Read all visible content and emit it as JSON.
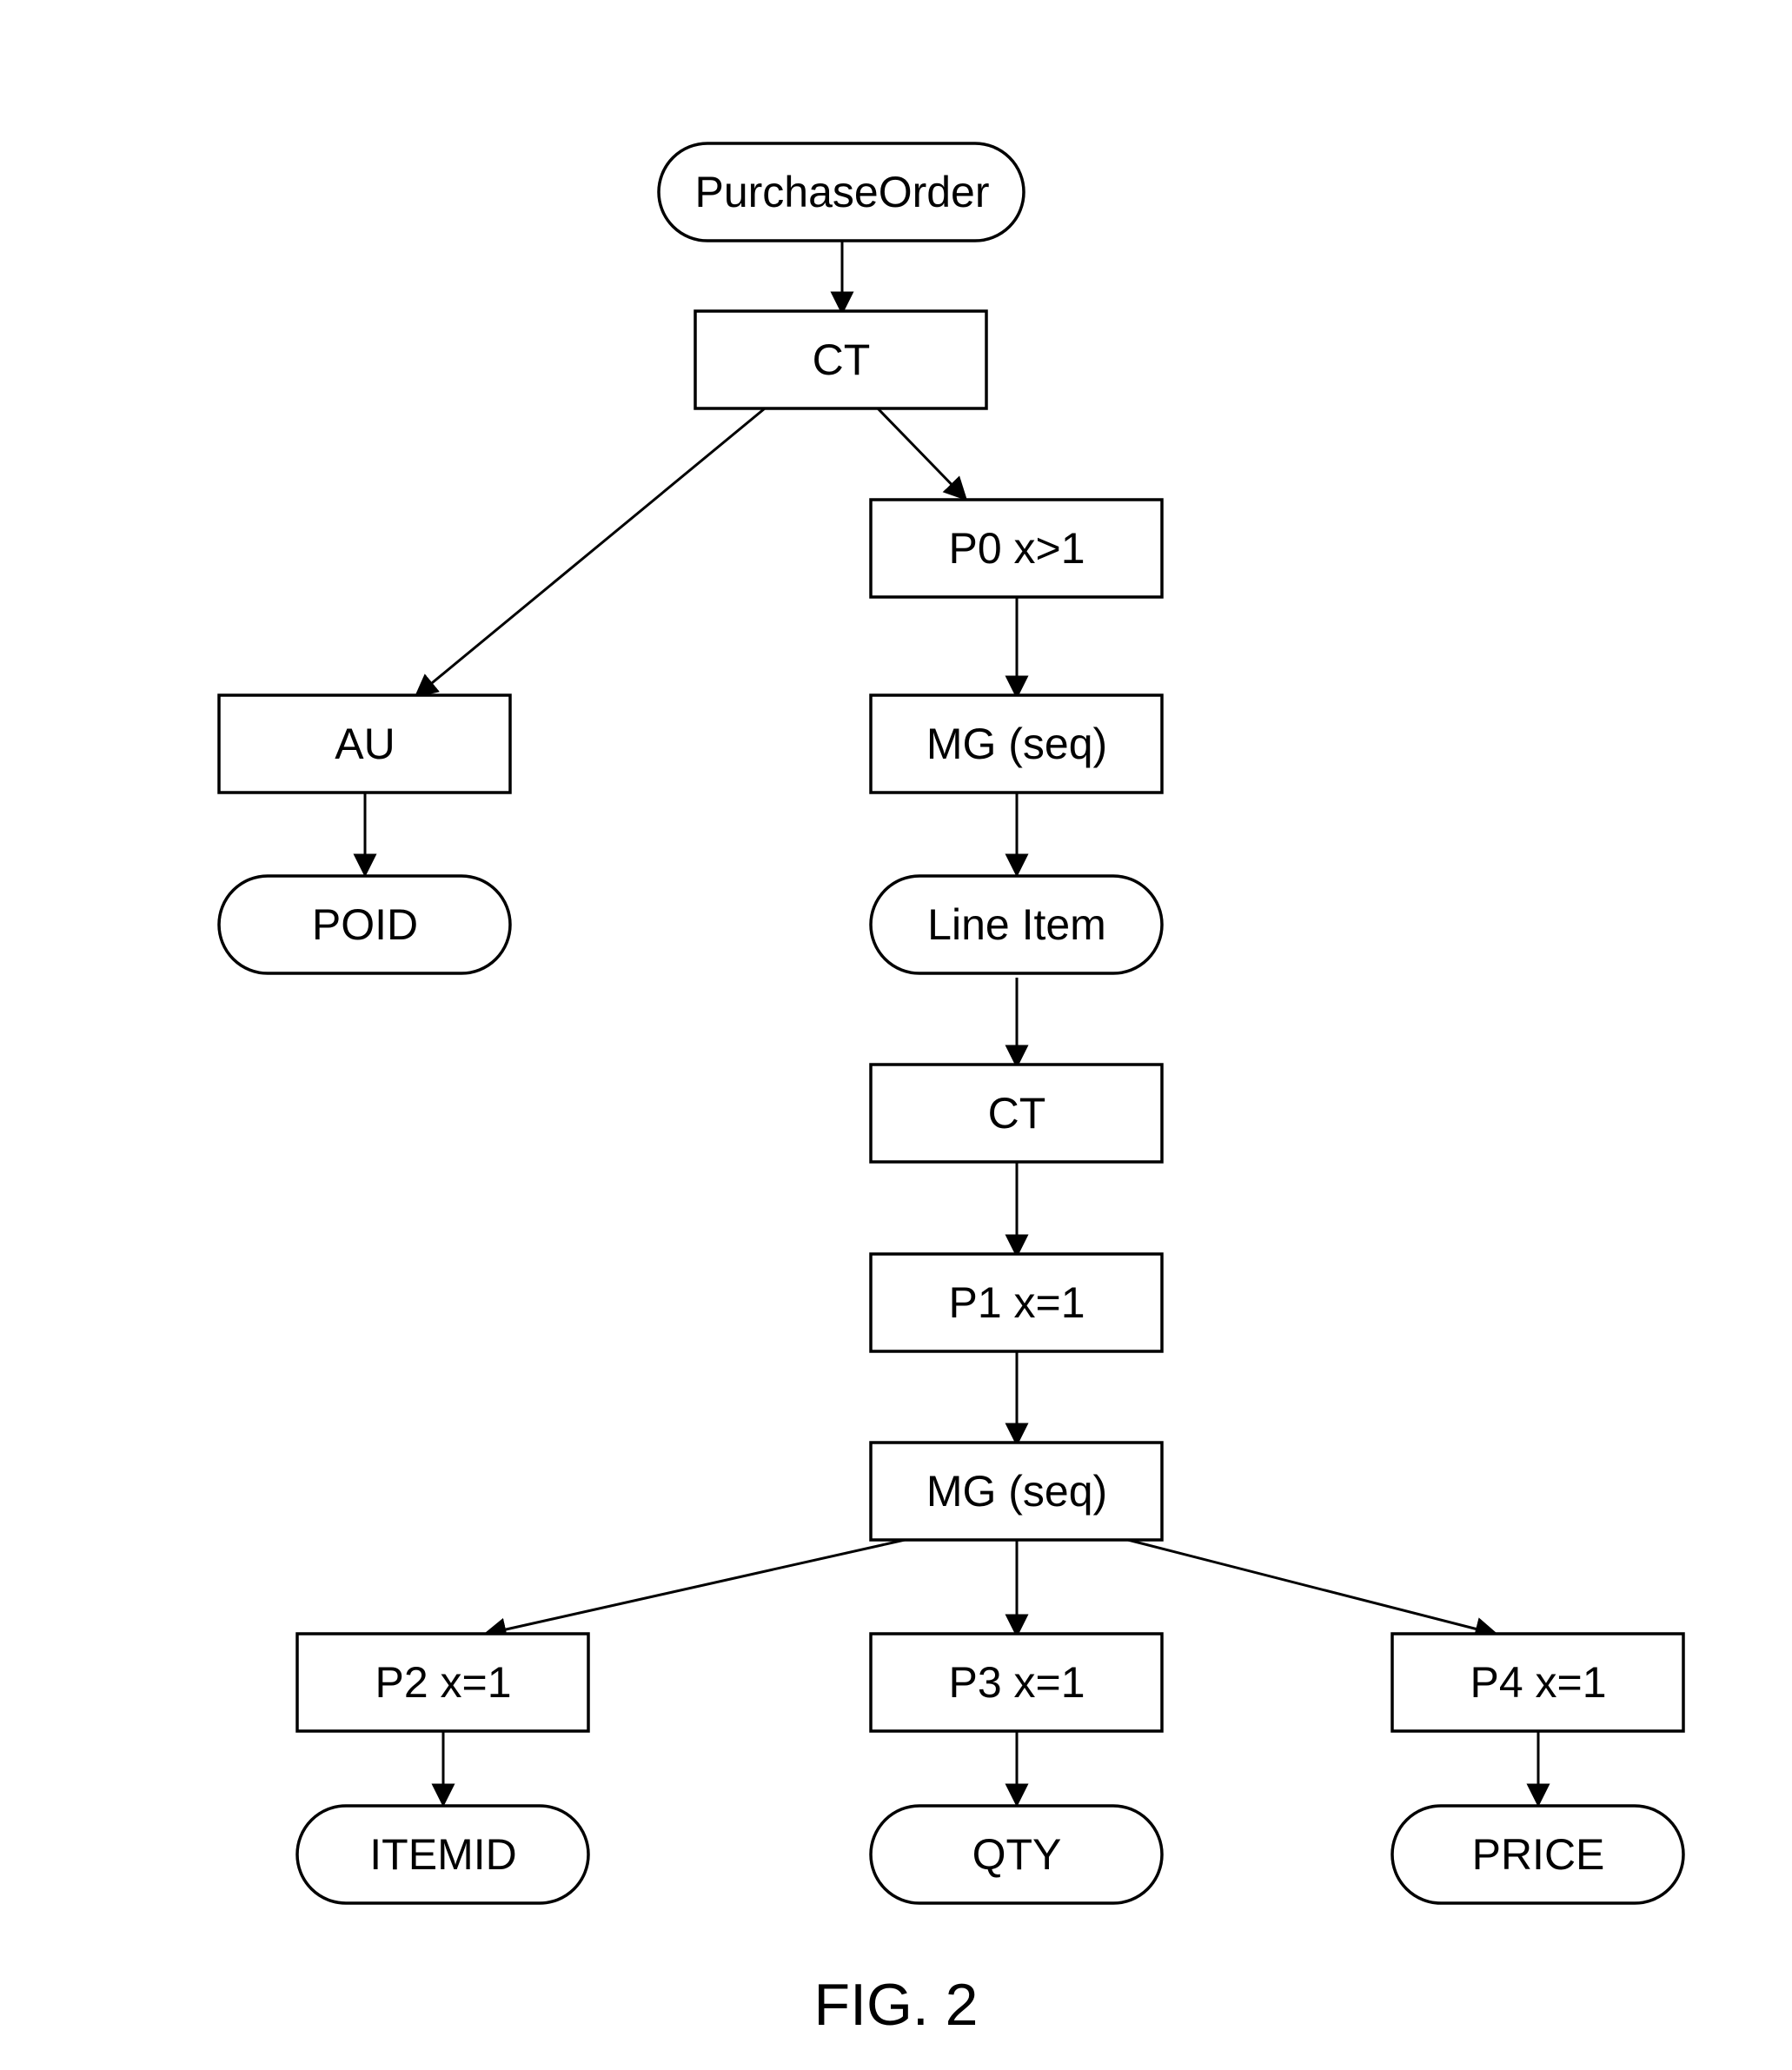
{
  "diagram": {
    "caption": "FIG. 2",
    "nodes": {
      "purchaseOrder": "PurchaseOrder",
      "ct1": "CT",
      "au": "AU",
      "poid": "POID",
      "p0": "P0 x>1",
      "mg1": "MG (seq)",
      "lineItem": "Line Item",
      "ct2": "CT",
      "p1": "P1 x=1",
      "mg2": "MG (seq)",
      "p2": "P2 x=1",
      "p3": "P3 x=1",
      "p4": "P4 x=1",
      "itemid": "ITEMID",
      "qty": "QTY",
      "price": "PRICE"
    }
  }
}
